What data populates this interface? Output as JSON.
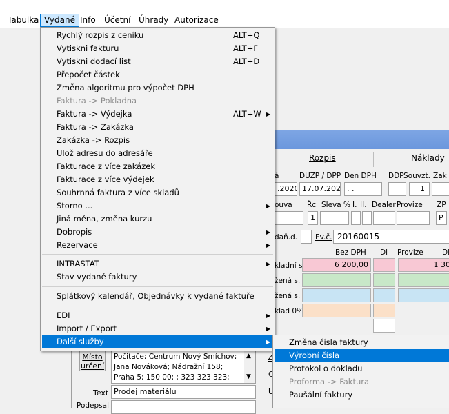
{
  "menubar": {
    "items": [
      "Tabulka",
      "Vydané",
      "Info",
      "Účetní",
      "Úhrady",
      "Autorizace"
    ]
  },
  "menu": {
    "items": [
      {
        "label": "Rychlý rozpis z ceníku",
        "shortcut": "ALT+Q"
      },
      {
        "label": "Vytiskni fakturu",
        "shortcut": "ALT+F"
      },
      {
        "label": "Vytiskni dodací list",
        "shortcut": "ALT+D"
      },
      {
        "label": "Přepočet částek"
      },
      {
        "label": "Změna algoritmu pro výpočet DPH"
      },
      {
        "label": "Faktura -> Pokladna"
      },
      {
        "label": "Faktura -> Výdejka",
        "shortcut": "ALT+W"
      },
      {
        "label": "Faktura -> Zakázka"
      },
      {
        "label": "Zakázka -> Rozpis"
      },
      {
        "label": "Ulož adresu do adresáře"
      },
      {
        "label": "Fakturace z více zakázek"
      },
      {
        "label": "Fakturace z více výdejek"
      },
      {
        "label": "Souhrnná faktura z více skladů"
      },
      {
        "label": "Storno ..."
      },
      {
        "label": "Jiná měna, změna kurzu"
      },
      {
        "label": "Dobropis"
      },
      {
        "label": "Rezervace"
      },
      {
        "label": "INTRASTAT"
      },
      {
        "label": "Stav vydané faktury"
      },
      {
        "label": "Splátkový kalendář, Objednávky k vydané faktuře"
      },
      {
        "label": "EDI"
      },
      {
        "label": "Import / Export"
      },
      {
        "label": "Další služby"
      }
    ]
  },
  "submenu": {
    "items": [
      "Změna čísla faktury",
      "Výrobní čísla",
      "Protokol o dokladu",
      "Proforma -> Faktura",
      "Paušální faktury"
    ]
  },
  "form": {
    "tab_rozpis": "Rozpis",
    "tab_naklady": "Náklady",
    "col_headers": [
      "á",
      "DUZP / DPP",
      "Den DPH",
      "DDP",
      "Souvzt.",
      "Zak"
    ],
    "date1": ".2020",
    "date2": "17.07.2020",
    "date3": ". .",
    "souvzt_val": "1",
    "row2_headers": [
      "ouva",
      "Řc",
      "Sleva %",
      "I.",
      "II.",
      "Dealer",
      "Provize",
      "ZP"
    ],
    "rc_val": "1",
    "zp_val": "P",
    "dand_label": "daň.d.",
    "evc_label": "Ev.č.",
    "evc_value": "20160015",
    "bez_dph": "Bez DPH",
    "di": "Di",
    "provize": "Provize",
    "dp": "DP",
    "row_labels": [
      "kladní s.",
      "žená s.",
      "žená s.",
      "klad 0%"
    ],
    "val_zakladni": "6 200,00",
    "val_provize": "1 30",
    "misto_label": "Místo určení",
    "address": "Počitače; Centrum Nový Smíchov; Jana Nováková; Nádražní 158; Praha 5; 150 00; ; 323 323 323;",
    "text_label": "Text",
    "text_value": "Prodej materiálu",
    "podpis_label": "Podepsal",
    "side_z": "Z",
    "side_c": "C",
    "side_u": "U"
  },
  "colors": {
    "highlight": "#0078d7",
    "menubar_open": "#cce8ff"
  }
}
